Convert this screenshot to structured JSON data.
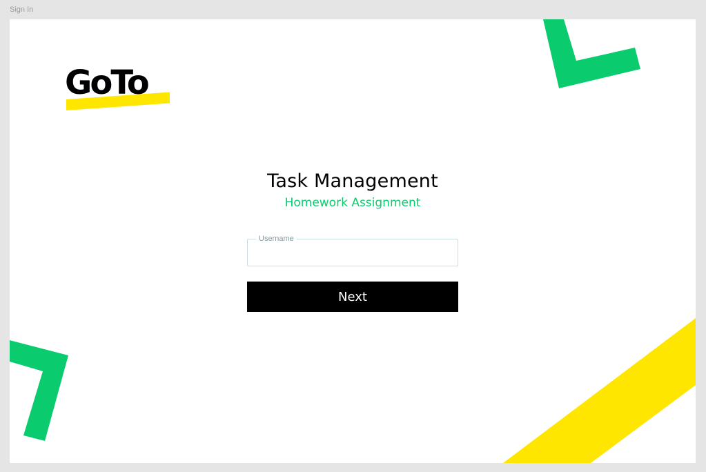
{
  "frame": {
    "label": "Sign In"
  },
  "brand": {
    "logo_text": "GoTo",
    "green": "#0acc6e",
    "yellow": "#ffe600"
  },
  "main": {
    "title": "Task Management",
    "subtitle": "Homework Assignment",
    "username_label": "Username",
    "username_value": "",
    "next_label": "Next"
  },
  "decorations": [
    "green-chevron-top-right",
    "green-chevron-bottom-left",
    "yellow-stripe-bottom-right"
  ]
}
